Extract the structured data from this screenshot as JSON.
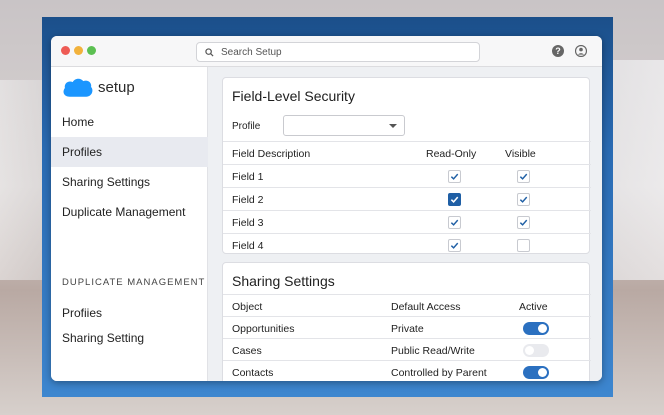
{
  "app": {
    "logo_text": "setup",
    "search_placeholder": "Search Setup"
  },
  "sidebar": {
    "items": [
      {
        "label": "Home",
        "active": false
      },
      {
        "label": "Profiles",
        "active": true
      },
      {
        "label": "Sharing Settings",
        "active": false
      },
      {
        "label": "Duplicate Management",
        "active": false
      }
    ],
    "section_heading": "DUPLICATE MANAGEMENT",
    "section_items": [
      {
        "label": "Profiies"
      },
      {
        "label": "Sharing Setting"
      }
    ]
  },
  "field_level_security": {
    "title": "Field-Level Security",
    "profile_label": "Profile",
    "profile_value": "",
    "headers": [
      "Field Description",
      "Read-Only",
      "Visible"
    ],
    "rows": [
      {
        "field": "Field 1",
        "read_only": true,
        "read_only_style": "check",
        "visible": true
      },
      {
        "field": "Field 2",
        "read_only": true,
        "read_only_style": "filled",
        "visible": true
      },
      {
        "field": "Field 3",
        "read_only": true,
        "read_only_style": "check",
        "visible": true
      },
      {
        "field": "Field 4",
        "read_only": true,
        "read_only_style": "check",
        "visible": false
      }
    ]
  },
  "sharing_settings": {
    "title": "Sharing Settings",
    "headers": [
      "Object",
      "Default Access",
      "Active"
    ],
    "rows": [
      {
        "object": "Opportunities",
        "access": "Private",
        "active": true
      },
      {
        "object": "Cases",
        "access": "Public Read/Write",
        "active": false
      },
      {
        "object": "Contacts",
        "access": "Controlled by Parent",
        "active": true
      }
    ]
  },
  "colors": {
    "accent": "#1f5fa5",
    "toggle_on": "#2b70c0",
    "logo_blue": "#1b96ff"
  }
}
